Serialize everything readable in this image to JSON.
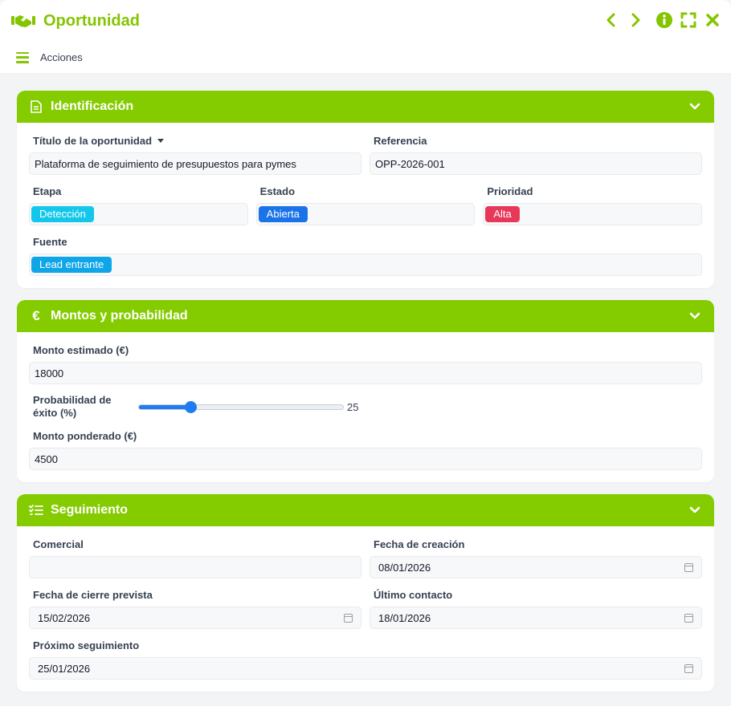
{
  "window": {
    "title": "Oportunidad",
    "accent": "#84c500",
    "icon": "handshake-icon"
  },
  "menu": {
    "actions_label": "Acciones"
  },
  "sections": {
    "identificacion": {
      "title": "Identificación",
      "titulo_label": "Título de la oportunidad",
      "titulo_value": "Plataforma de seguimiento de presupuestos para pymes",
      "referencia_label": "Referencia",
      "referencia_value": "OPP-2026-001",
      "etapa_label": "Etapa",
      "etapa_value": "Detección",
      "etapa_color": "#12c7ea",
      "estado_label": "Estado",
      "estado_value": "Abierta",
      "estado_color": "#1a73e8",
      "prioridad_label": "Prioridad",
      "prioridad_value": "Alta",
      "prioridad_color": "#e8385a",
      "fuente_label": "Fuente",
      "fuente_value": "Lead entrante",
      "fuente_color": "#0ea5e9"
    },
    "montos": {
      "title": "Montos y probabilidad",
      "monto_label": "Monto estimado (€)",
      "monto_value": "18000",
      "prob_label": "Probabilidad de éxito (%)",
      "prob_value": "25",
      "prob_fraction": 0.25,
      "ponderado_label": "Monto ponderado (€)",
      "ponderado_value": "4500"
    },
    "seguimiento": {
      "title": "Seguimiento",
      "comercial_label": "Comercial",
      "comercial_value": "",
      "creacion_label": "Fecha de creación",
      "creacion_value": "08/01/2026",
      "cierre_label": "Fecha de cierre prevista",
      "cierre_value": "15/02/2026",
      "contacto_label": "Último contacto",
      "contacto_value": "18/01/2026",
      "proximo_label": "Próximo seguimiento",
      "proximo_value": "25/01/2026"
    }
  }
}
